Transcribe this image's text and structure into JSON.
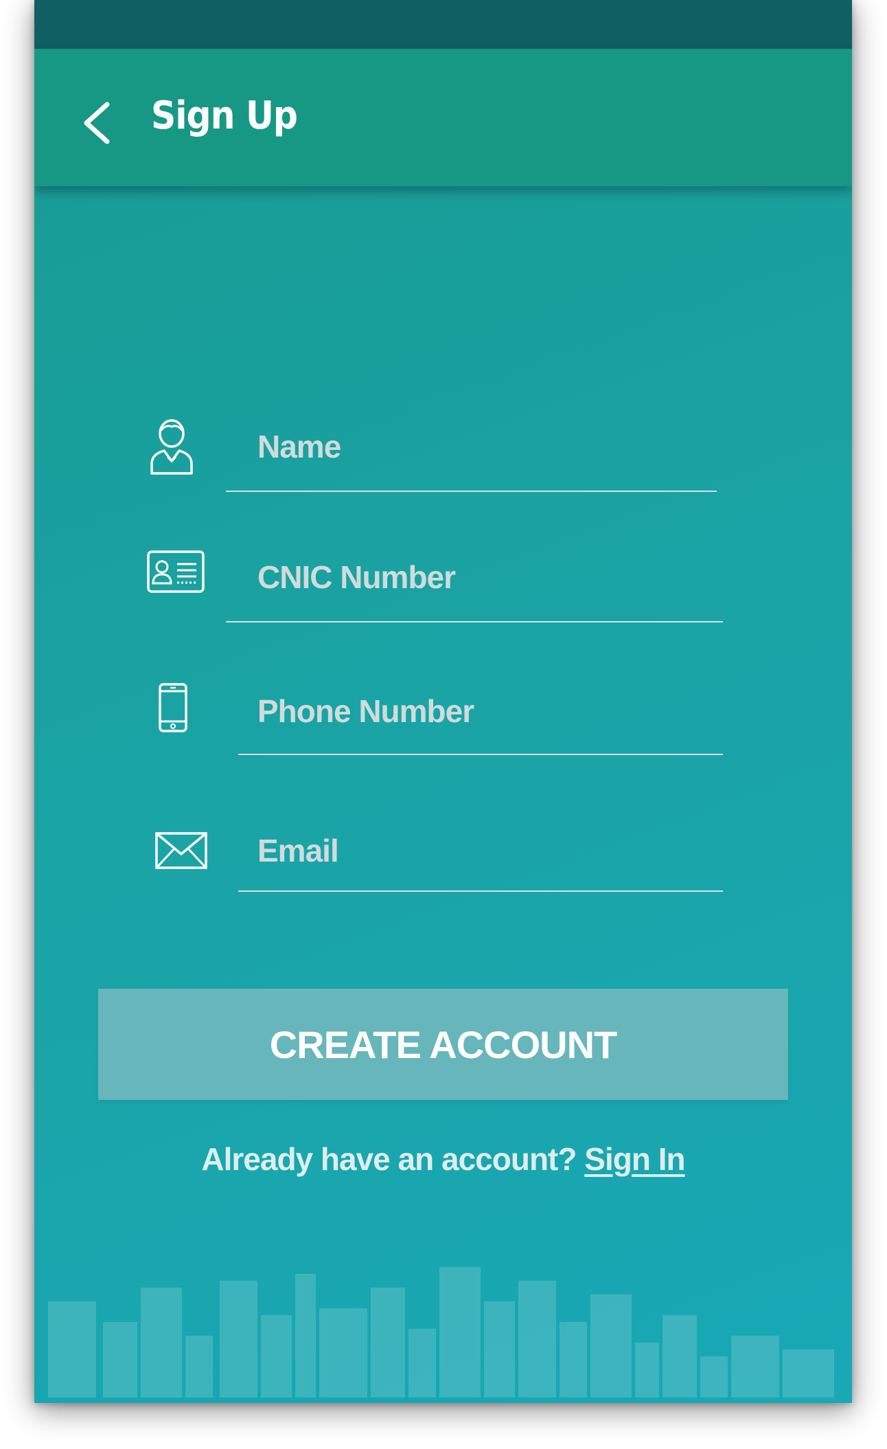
{
  "app_bar": {
    "title": "Sign Up"
  },
  "icons": {
    "back": "chevron-left-icon",
    "name": "user-icon",
    "cnic": "id-card-icon",
    "phone": "smartphone-icon",
    "email": "envelope-icon"
  },
  "form": {
    "name": {
      "placeholder": "Name",
      "value": ""
    },
    "cnic": {
      "placeholder": "CNIC Number",
      "value": ""
    },
    "phone": {
      "placeholder": "Phone Number",
      "value": ""
    },
    "email": {
      "placeholder": "Email",
      "value": ""
    }
  },
  "actions": {
    "create_account_label": "CREATE ACCOUNT",
    "already_text": "Already have an account? ",
    "sign_in_label": "Sign In"
  },
  "colors": {
    "status_bar": "#0f5f63",
    "app_bar": "#169885",
    "background": "#1aa3a3",
    "button": "#66b6bb",
    "text": "#ffffff"
  }
}
